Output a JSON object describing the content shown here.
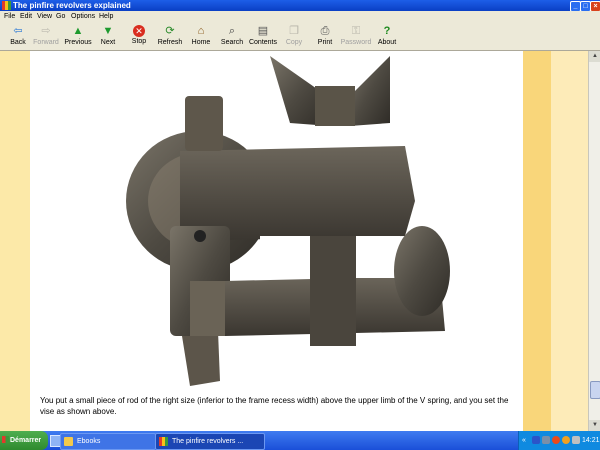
{
  "window": {
    "title": "The pinfire revolvers explained",
    "controls": [
      "minimize",
      "maximize",
      "close"
    ]
  },
  "menu": [
    "File",
    "Edit",
    "View",
    "Go",
    "Options",
    "Help"
  ],
  "toolbar": [
    {
      "label": "Back",
      "icon": "back-arrow-icon",
      "enabled": true
    },
    {
      "label": "Forward",
      "icon": "forward-arrow-icon",
      "enabled": false
    },
    {
      "label": "Previous",
      "icon": "up-arrow-icon",
      "enabled": true
    },
    {
      "label": "Next",
      "icon": "down-arrow-icon",
      "enabled": true
    },
    {
      "label": "Stop",
      "icon": "stop-icon",
      "enabled": true
    },
    {
      "label": "Refresh",
      "icon": "refresh-icon",
      "enabled": true
    },
    {
      "label": "Home",
      "icon": "home-icon",
      "enabled": true
    },
    {
      "label": "Search",
      "icon": "search-icon",
      "enabled": true
    },
    {
      "label": "Contents",
      "icon": "contents-icon",
      "enabled": true
    },
    {
      "label": "Copy",
      "icon": "copy-icon",
      "enabled": false
    },
    {
      "label": "Print",
      "icon": "print-icon",
      "enabled": true
    },
    {
      "label": "Password",
      "icon": "key-icon",
      "enabled": false
    },
    {
      "label": "About",
      "icon": "about-icon",
      "enabled": true
    }
  ],
  "content": {
    "caption": "You put a small piece of rod of the right size (inferior to the frame recess width) above the upper limb of the V spring, and you set the vise as shown above."
  },
  "taskbar": {
    "start_label": "Démarrer",
    "tasks": [
      {
        "label": "Ebooks",
        "active": false
      },
      {
        "label": "The pinfire revolvers ...",
        "active": true
      }
    ],
    "tray_collapse": "«",
    "clock": "14:21"
  },
  "colors": {
    "page_background": "#ffffff",
    "side_strip": "#f9d67a",
    "margin": "#fdebb8",
    "taskbar": "#2458dc",
    "start_button": "#3a9a3a"
  }
}
